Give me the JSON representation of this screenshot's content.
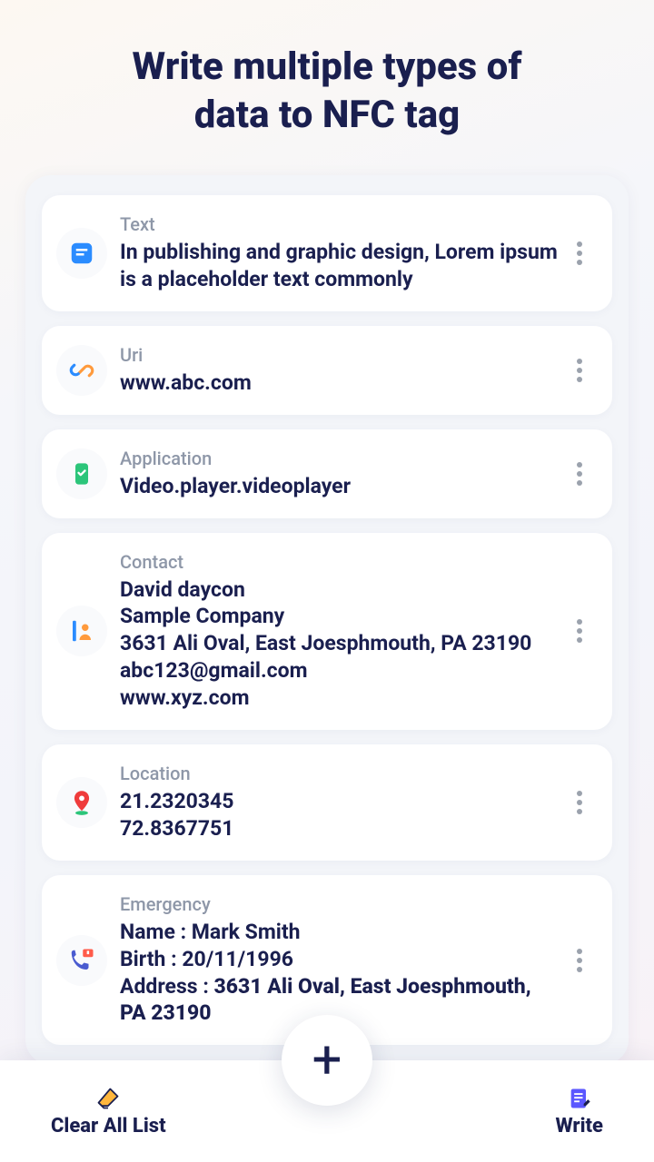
{
  "header": {
    "title_line1": "Write multiple types of",
    "title_line2": "data to NFC tag"
  },
  "items": [
    {
      "type": "Text",
      "lines": [
        "In publishing and graphic design, Lorem ipsum is a placeholder text commonly"
      ]
    },
    {
      "type": "Uri",
      "lines": [
        "www.abc.com"
      ]
    },
    {
      "type": "Application",
      "lines": [
        "Video.player.videoplayer"
      ]
    },
    {
      "type": "Contact",
      "lines": [
        "David daycon",
        "Sample Company",
        "3631 Ali Oval, East Joesphmouth, PA 23190",
        "abc123@gmail.com",
        "www.xyz.com"
      ]
    },
    {
      "type": "Location",
      "lines": [
        "21.2320345",
        "72.8367751"
      ]
    },
    {
      "type": "Emergency",
      "emergency": {
        "name_label": "Name : ",
        "name_value": "Mark Smith",
        "birth_label": "Birth : ",
        "birth_value": "20/11/1996",
        "address_label": "Address : ",
        "address_value": "3631 Ali Oval, East Joesphmouth, PA 23190"
      }
    }
  ],
  "bottom": {
    "clear": "Clear All List",
    "write": "Write"
  }
}
